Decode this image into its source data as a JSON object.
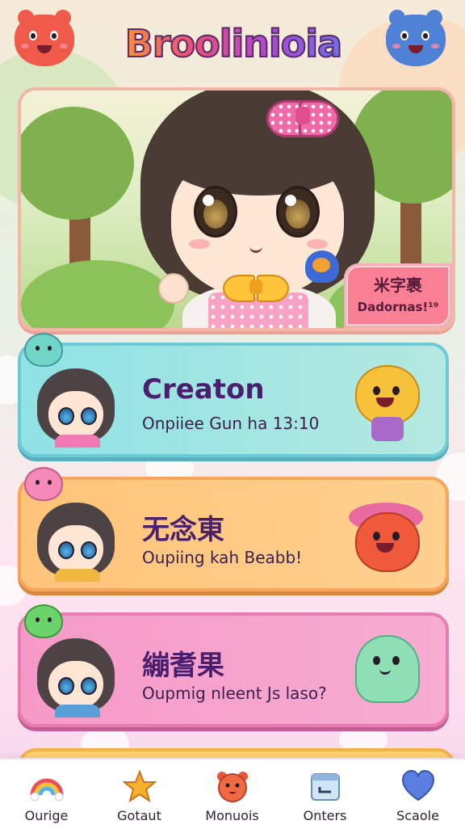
{
  "header": {
    "title": "Broolinioia",
    "left_mascot_icon": "red-bear-mascot-icon",
    "right_mascot_icon": "blue-bear-mascot-icon"
  },
  "hero": {
    "illustration": "chibi-girl-with-pink-bow",
    "badge_line1": "米字裹",
    "badge_line2": "Dadornas!¹⁹"
  },
  "cards": [
    {
      "title": "Creaton",
      "subtitle": "Onpiiee Gun ha 13:10",
      "color": "#8fe2e5",
      "pet_color": "#6fd6c8",
      "mascot": "yellow-bear-mascot-icon"
    },
    {
      "title": "无念東",
      "subtitle": "Oupiing kah Beabb!",
      "color": "#ffc47a",
      "pet_color": "#f58ab8",
      "mascot": "red-fruit-mascot-icon"
    },
    {
      "title": "繃耆果",
      "subtitle": "Oupmig nleent Js laso?",
      "color": "#f59ac8",
      "pet_color": "#6ad46a",
      "mascot": "green-ghost-mascot-icon"
    }
  ],
  "nav": [
    {
      "label": "Ourige",
      "icon": "rainbow-icon"
    },
    {
      "label": "Gotaut",
      "icon": "star-icon"
    },
    {
      "label": "Monuois",
      "icon": "bear-face-icon"
    },
    {
      "label": "Onters",
      "icon": "calendar-icon"
    },
    {
      "label": "Scaole",
      "icon": "heart-icon"
    }
  ]
}
